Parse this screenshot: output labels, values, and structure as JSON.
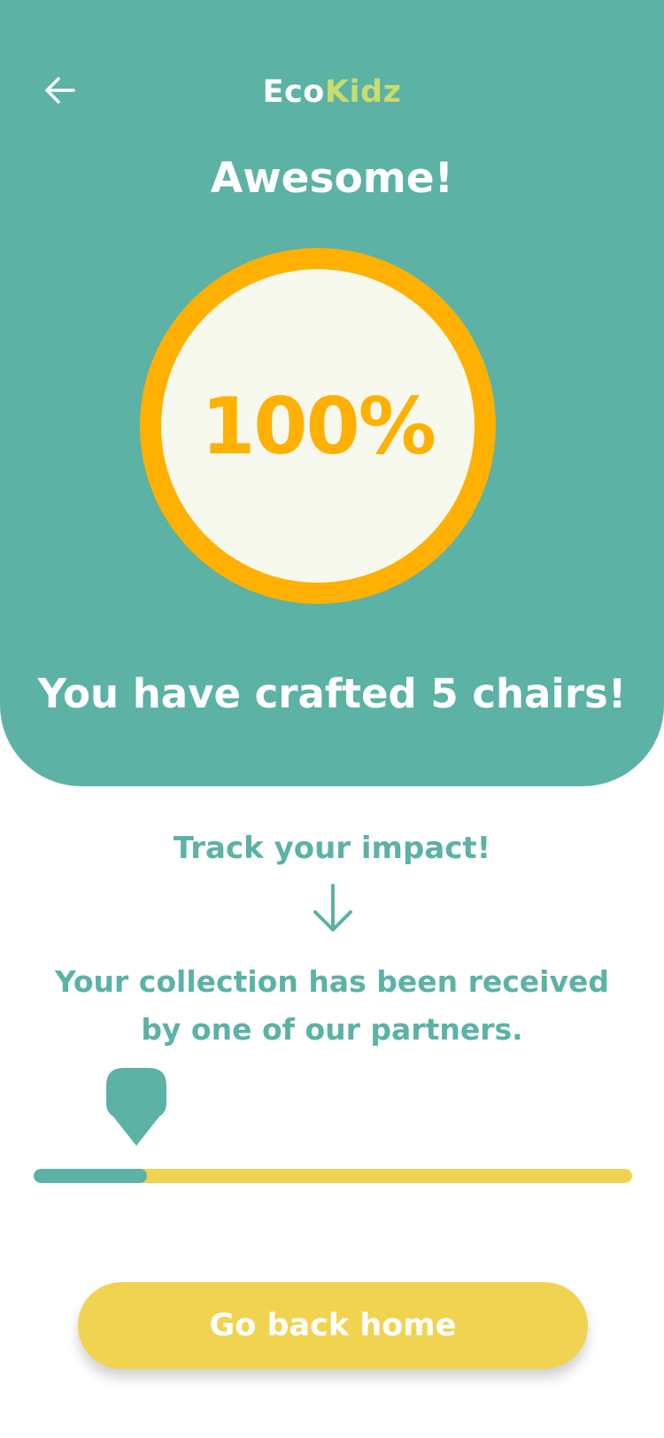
{
  "header": {
    "brand_part1": "Eco",
    "brand_part2": "Kidz",
    "back_icon": "arrow-left-icon"
  },
  "hero": {
    "headline": "Awesome!",
    "progress_percent_label": "100%",
    "progress_percent": 100,
    "crafted_message": "You have crafted 5 chairs!"
  },
  "impact": {
    "title": "Track your impact!",
    "arrow_icon": "arrow-down-icon",
    "status_message": "Your collection has been received by one of our partners.",
    "marker_icon": "location-pin-icon",
    "progress_fraction": 0.19
  },
  "actions": {
    "home_button_label": "Go back home"
  },
  "colors": {
    "primary": "#5bb2a5",
    "accent_orange": "#ffb000",
    "accent_yellow": "#f1d352",
    "brand_green": "#c9dc6c",
    "ring_inner": "#f8f9ee"
  }
}
